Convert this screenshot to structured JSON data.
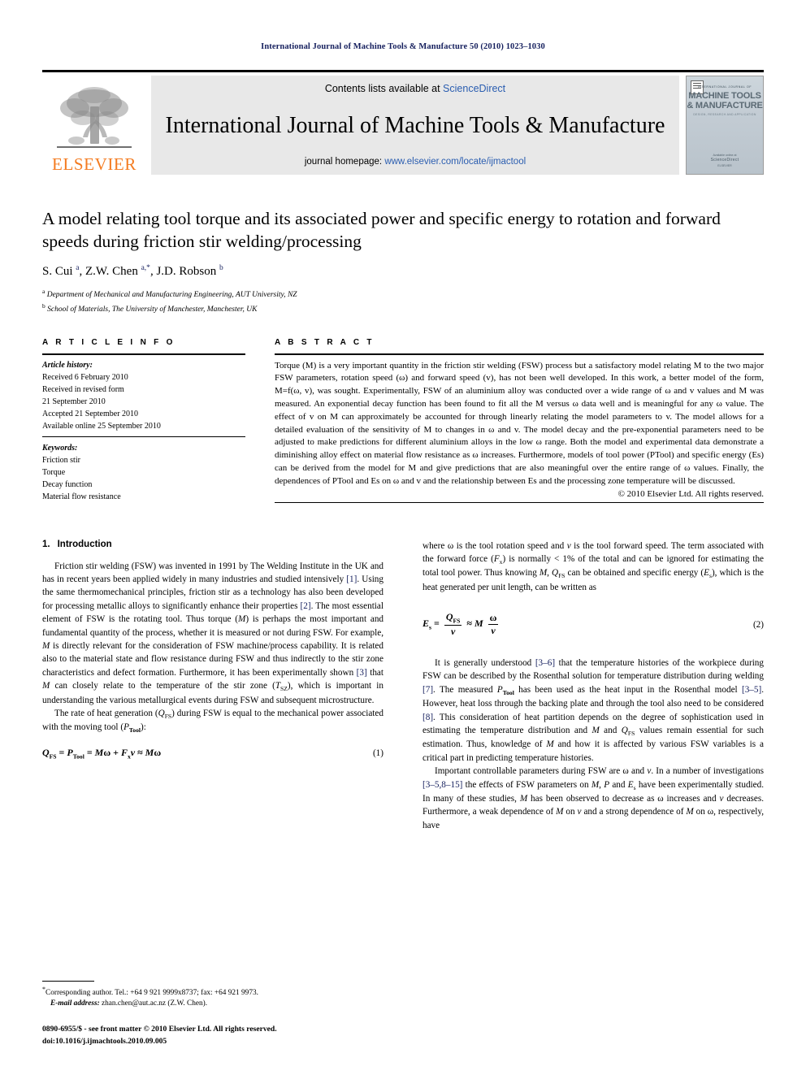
{
  "running_head": "International Journal of Machine Tools & Manufacture 50 (2010) 1023–1030",
  "masthead": {
    "contents_prefix": "Contents lists available at ",
    "sciencedirect": "ScienceDirect",
    "journal_title": "International Journal of Machine Tools & Manufacture",
    "homepage_prefix": "journal homepage: ",
    "homepage_url": "www.elsevier.com/locate/ijmactool",
    "publisher_wordmark": "ELSEVIER",
    "cover": {
      "eyebrow": "INTERNATIONAL JOURNAL OF",
      "line1": "MACHINE TOOLS",
      "line2": "& MANUFACTURE",
      "sub": "DESIGN, RESEARCH AND APPLICATION",
      "foot_small": "Available online at",
      "foot_big": "ScienceDirect",
      "foot_tiny": "ELSEVIER"
    },
    "accent_orange": "#f47b20",
    "link_blue": "#2a5db0",
    "banner_gray": "#e8e8e8"
  },
  "title": "A model relating tool torque and its associated power and specific energy to rotation and forward speeds during friction stir welding/processing",
  "authors_html": "S. Cui <sup>a</sup>, Z.W. Chen <sup>a,*</sup>, J.D. Robson <sup>b</sup>",
  "affiliations": [
    {
      "mark": "a",
      "text": "Department of Mechanical and Manufacturing Engineering, AUT University, NZ"
    },
    {
      "mark": "b",
      "text": "School of Materials, The University of Manchester, Manchester, UK"
    }
  ],
  "article_info": {
    "heading": "A R T I C L E   I N F O",
    "history_label": "Article history:",
    "history": [
      "Received 6 February 2010",
      "Received in revised form",
      "21 September 2010",
      "Accepted 21 September 2010",
      "Available online 25 September 2010"
    ],
    "keywords_label": "Keywords:",
    "keywords": [
      "Friction stir",
      "Torque",
      "Decay function",
      "Material flow resistance"
    ]
  },
  "abstract": {
    "heading": "A B S T R A C T",
    "text": "Torque (M) is a very important quantity in the friction stir welding (FSW) process but a satisfactory model relating M to the two major FSW parameters, rotation speed (ω) and forward speed (v), has not been well developed. In this work, a better model of the form, M=f(ω, v), was sought. Experimentally, FSW of an aluminium alloy was conducted over a wide range of ω and v values and M was measured. An exponential decay function has been found to fit all the M versus ω data well and is meaningful for any ω value. The effect of v on M can approximately be accounted for through linearly relating the model parameters to v. The model allows for a detailed evaluation of the sensitivity of M to changes in ω and v. The model decay and the pre-exponential parameters need to be adjusted to make predictions for different aluminium alloys in the low ω range. Both the model and experimental data demonstrate a diminishing alloy effect on material flow resistance as ω increases. Furthermore, models of tool power (PTool) and specific energy (Es) can be derived from the model for M and give predictions that are also meaningful over the entire range of ω values. Finally, the dependences of PTool and Es on ω and v and the relationship between Es and the processing zone temperature will be discussed.",
    "copyright": "© 2010 Elsevier Ltd. All rights reserved."
  },
  "sections": {
    "intro_number": "1.",
    "intro_title": "Introduction"
  },
  "left_column": {
    "p1": "Friction stir welding (FSW) was invented in 1991 by The Welding Institute in the UK and has in recent years been applied widely in many industries and studied intensively [1]. Using the same thermomechanical principles, friction stir as a technology has also been developed for processing metallic alloys to significantly enhance their properties [2]. The most essential element of FSW is the rotating tool. Thus torque (M) is perhaps the most important and fundamental quantity of the process, whether it is measured or not during FSW. For example, M is directly relevant for the consideration of FSW machine/process capability. It is related also to the material state and flow resistance during FSW and thus indirectly to the stir zone characteristics and defect formation. Furthermore, it has been experimentally shown [3] that M can closely relate to the temperature of the stir zone (TSZ), which is important in understanding the various metallurgical events during FSW and subsequent microstructure.",
    "p2": "The rate of heat generation (QFS) during FSW is equal to the mechanical power associated with the moving tool (PTool):",
    "eq1_number": "(1)",
    "eq1": "QFS = PTool = Mω + Fx v ≈ Mω"
  },
  "right_column": {
    "p1": "where ω is the tool rotation speed and v is the tool forward speed. The term associated with the forward force (Fx) is normally < 1% of the total and can be ignored for estimating the total tool power. Thus knowing M, QFS can be obtained and specific energy (Es), which is the heat generated per unit length, can be written as",
    "eq2_number": "(2)",
    "eq2": "Es = QFS / v ≈ M ω / v",
    "p2": "It is generally understood [3–6] that the temperature histories of the workpiece during FSW can be described by the Rosenthal solution for temperature distribution during welding [7]. The measured PTool has been used as the heat input in the Rosenthal model [3–5]. However, heat loss through the backing plate and through the tool also need to be considered [8]. This consideration of heat partition depends on the degree of sophistication used in estimating the temperature distribution and M and QFS values remain essential for such estimation. Thus, knowledge of M and how it is affected by various FSW variables is a critical part in predicting temperature histories.",
    "p3": "Important controllable parameters during FSW are ω and v. In a number of investigations [3–5,8–15] the effects of FSW parameters on M, P and Es have been experimentally studied. In many of these studies, M has been observed to decrease as ω increases and v decreases. Furthermore, a weak dependence of M on v and a strong dependence of M on ω, respectively, have"
  },
  "footnotes": {
    "corresponding_star": "*",
    "corresponding": "Corresponding author. Tel.: +64 9 921 9999x8737; fax: +64 921 9973.",
    "email_label": "E-mail address:",
    "email": "zhan.chen@aut.ac.nz (Z.W. Chen).",
    "issn_line": "0890-6955/$ - see front matter © 2010 Elsevier Ltd. All rights reserved.",
    "doi_line": "doi:10.1016/j.ijmachtools.2010.09.005"
  }
}
